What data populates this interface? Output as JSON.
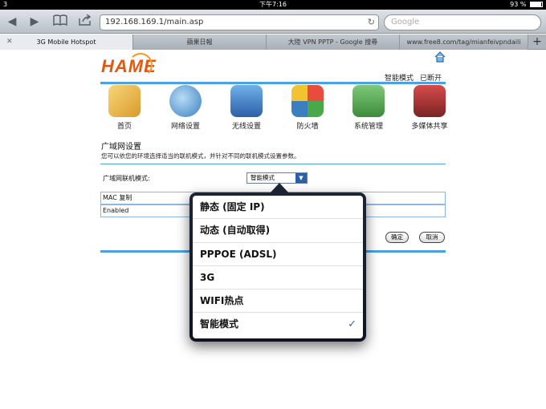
{
  "statusbar": {
    "carrier": "3",
    "time": "下午7:16",
    "battery": "93 %"
  },
  "toolbar": {
    "url": "192.168.169.1/main.asp",
    "search_placeholder": "Google"
  },
  "tabs": [
    {
      "label": "3G Mobile Hotspot",
      "active": true
    },
    {
      "label": "蘋果日報",
      "active": false
    },
    {
      "label": "大陸 VPN PPTP - Google 搜尋",
      "active": false
    },
    {
      "label": "www.free8.com/tag/mianfeivpndaili",
      "active": false
    }
  ],
  "page": {
    "logo": "HAME",
    "mode": "智能模式",
    "connection": "已断开",
    "nav": [
      "首页",
      "网络设置",
      "无线设置",
      "防火墙",
      "系统管理",
      "多媒体共享"
    ],
    "section_title": "广域网设置",
    "section_desc": "您可以依您的环境选择适当的联机模式，并针对不同的联机模式设置参数。",
    "wan_label": "广域网联机模式:",
    "wan_value": "智能模式",
    "rows": [
      "MAC 复制",
      "Enabled"
    ],
    "ok_button": "确定",
    "cancel_button": "取消"
  },
  "popover": {
    "options": [
      "静态 (固定 IP)",
      "动态 (自动取得)",
      "PPPOE (ADSL)",
      "3G",
      "WIFI热点",
      "智能模式"
    ],
    "selected_index": 5
  },
  "colors": {
    "accent": "#4aa3e0",
    "logo": "#e8560c",
    "check": "#3966b0"
  }
}
